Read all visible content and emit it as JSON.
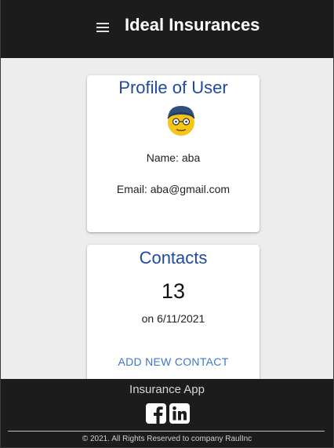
{
  "header": {
    "title": "Ideal Insurances",
    "menu_icon": "hamburger-menu-icon"
  },
  "profile": {
    "title": "Profile of User",
    "avatar_icon": "turban-face-emoji",
    "name_line": "Name: aba",
    "email_line": "Email: aba@gmail.com"
  },
  "contacts": {
    "title": "Contacts",
    "count": "13",
    "date_line": "on 6/11/2021",
    "add_button_label": "ADD NEW CONTACT"
  },
  "footer": {
    "title": "Insurance App",
    "social_icons": [
      "facebook-icon",
      "linkedin-icon"
    ],
    "copyright": "© 2021. All Rights Reserved to company RaulInc"
  },
  "colors": {
    "header_bg": "#1c1c1c",
    "page_bg": "#ededed",
    "card_title": "#1f4aa0",
    "link": "#3b78c9"
  }
}
